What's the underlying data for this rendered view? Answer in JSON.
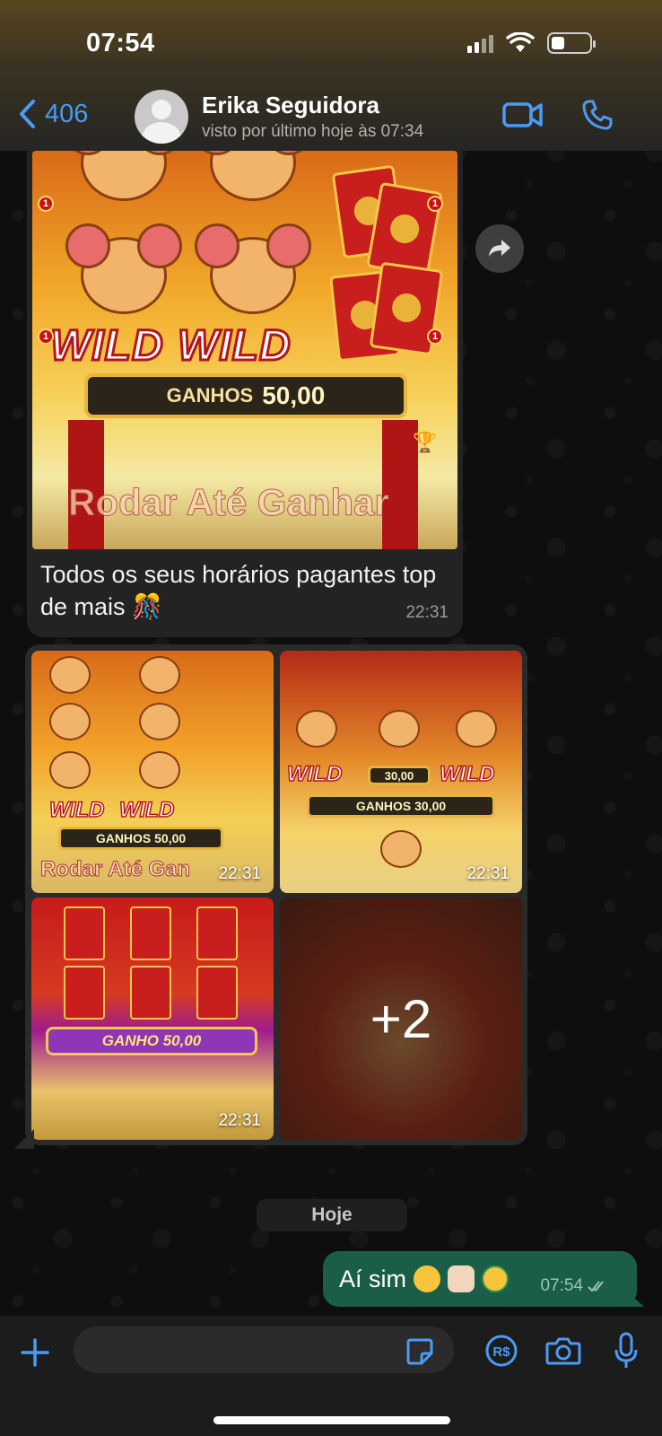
{
  "status_bar": {
    "time": "07:54"
  },
  "header": {
    "back_label": "406",
    "contact_name": "Erika Seguidora",
    "contact_status": "visto por último hoje às 07:34"
  },
  "message1": {
    "image": {
      "wild_left": "WILD",
      "wild_right": "WILD",
      "ganhos_label": "GANHOS",
      "ganhos_value": "50,00",
      "banner": "Rodar Até Ganhar"
    },
    "caption": "Todos os seus horários  pagantes top de mais 🎊",
    "time": "22:31"
  },
  "album": {
    "tiles": [
      {
        "time": "22:31",
        "wild1": "WILD",
        "wild2": "WILD",
        "bar": "GANHOS 50,00",
        "banner": "Rodar Até Gan"
      },
      {
        "time": "22:31",
        "wild1": "WILD",
        "wild2": "WILD",
        "middle": "30,00",
        "bar": "GANHOS 30,00"
      },
      {
        "time": "22:31",
        "bar": "GANHO 50,00"
      },
      {
        "more": "+2"
      }
    ]
  },
  "date_separator": "Hoje",
  "outgoing": {
    "text": "Aí sim",
    "emojis": [
      "heart-eyes-emoji",
      "clapping-hands-emoji",
      "money-mouth-emoji"
    ],
    "time": "07:54"
  },
  "colors": {
    "accent": "#4a9bf5",
    "outgoing_bubble": "#1b5e48",
    "incoming_bubble": "#232323"
  }
}
